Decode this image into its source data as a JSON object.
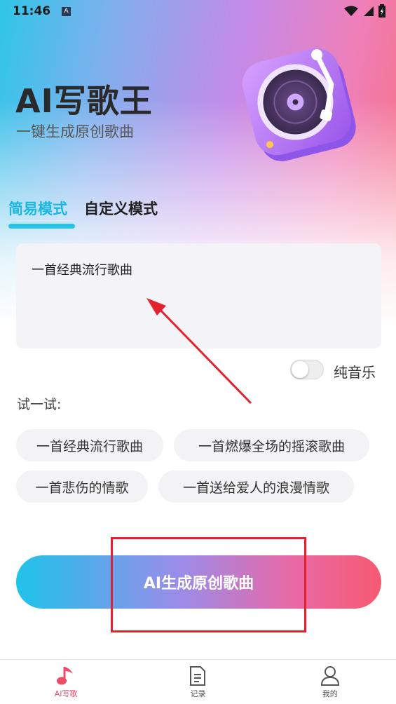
{
  "status_bar": {
    "time": "11:46",
    "notif_glyph": "A"
  },
  "header": {
    "title": "AI写歌王",
    "subtitle": "一键生成原创歌曲"
  },
  "tabs": [
    {
      "label": "简易模式",
      "active": true
    },
    {
      "label": "自定义模式",
      "active": false
    }
  ],
  "prompt": {
    "value": "一首经典流行歌曲"
  },
  "pure_music": {
    "label": "纯音乐",
    "on": false
  },
  "suggestions": {
    "label": "试一试:",
    "items": [
      "一首经典流行歌曲",
      "一首燃爆全场的摇滚歌曲",
      "一首悲伤的情歌",
      "一首送给爱人的浪漫情歌"
    ]
  },
  "generate_button": {
    "label": "AI生成原创歌曲"
  },
  "bottom_nav": [
    {
      "label": "AI写歌",
      "icon": "music-note-icon",
      "active": true
    },
    {
      "label": "记录",
      "icon": "document-icon",
      "active": false
    },
    {
      "label": "我的",
      "icon": "user-icon",
      "active": false
    }
  ],
  "colors": {
    "accent": "#1cb7e0",
    "nav_active": "#ee4b64",
    "annotation": "#e4222f"
  }
}
